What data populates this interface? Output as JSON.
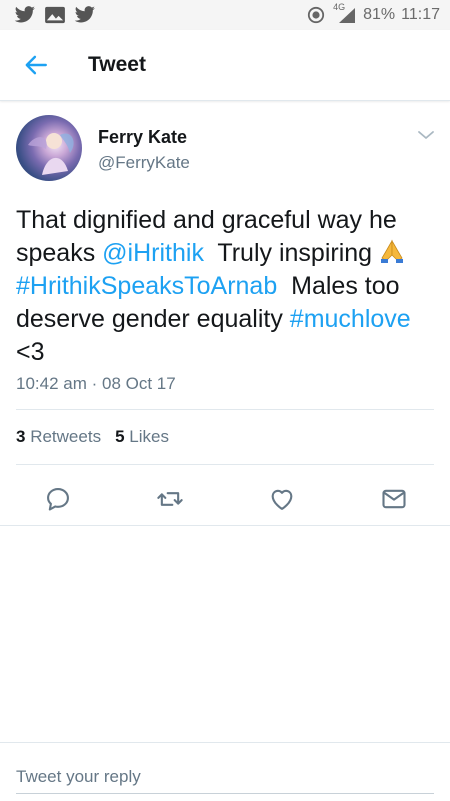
{
  "status_bar": {
    "icons": [
      "twitter-icon",
      "image-icon",
      "twitter-icon",
      "do-not-disturb-icon",
      "signal-4g-icon"
    ],
    "network": "4G",
    "battery": "81%",
    "time": "11:17"
  },
  "header": {
    "back_icon": "arrow-left-icon",
    "title": "Tweet"
  },
  "tweet": {
    "author_name": "Ferry Kate",
    "author_handle": "@FerryKate",
    "text_part1": "That dignified and graceful way he speaks ",
    "mention": "@iHrithik",
    "text_part2": "  Truly inspiring ",
    "emoji": "folded-hands-emoji",
    "hashtag1": "#HrithikSpeaksToArnab",
    "text_part3": "  Males too deserve gender equality ",
    "hashtag2": "#muchlove",
    "text_part4": " <3",
    "timestamp": "10:42 am · 08 Oct 17",
    "retweets_count": "3",
    "retweets_label": "Retweets",
    "likes_count": "5",
    "likes_label": "Likes"
  },
  "actions": [
    "reply-icon",
    "retweet-icon",
    "like-icon",
    "direct-message-icon"
  ],
  "colors": {
    "accent": "#1da1f2",
    "secondary_text": "#657786",
    "divider": "#e1e8ed"
  },
  "reply": {
    "placeholder": "Tweet your reply"
  }
}
